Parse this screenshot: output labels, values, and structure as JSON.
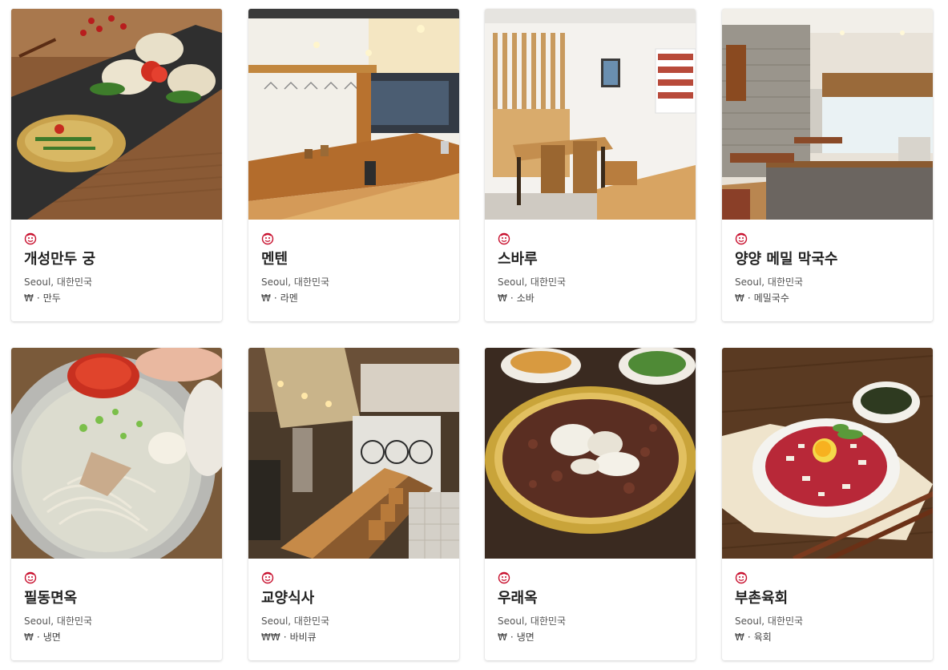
{
  "restaurants": [
    {
      "name": "개성만두 궁",
      "location": "Seoul, 대한민국",
      "price": "₩",
      "separator": "·",
      "category": "만두",
      "badge_icon": "michelin-bib-gourmand-icon",
      "photo": "dumplings-and-pancake-plate"
    },
    {
      "name": "멘텐",
      "location": "Seoul, 대한민국",
      "price": "₩",
      "separator": "·",
      "category": "라멘",
      "badge_icon": "michelin-bib-gourmand-icon",
      "photo": "wooden-counter-interior"
    },
    {
      "name": "스바루",
      "location": "Seoul, 대한민국",
      "price": "₩",
      "separator": "·",
      "category": "소바",
      "badge_icon": "michelin-bib-gourmand-icon",
      "photo": "wooden-tables-dining-room"
    },
    {
      "name": "양양 메밀 막국수",
      "location": "Seoul, 대한민국",
      "price": "₩",
      "separator": "·",
      "category": "메밀국수",
      "badge_icon": "michelin-bib-gourmand-icon",
      "photo": "brick-wall-dining-room"
    },
    {
      "name": "필동면옥",
      "location": "Seoul, 대한민국",
      "price": "₩",
      "separator": "·",
      "category": "냉면",
      "badge_icon": "michelin-bib-gourmand-icon",
      "photo": "cold-noodle-bowl"
    },
    {
      "name": "교양식사",
      "location": "Seoul, 대한민국",
      "price": "₩₩",
      "separator": "·",
      "category": "바비큐",
      "badge_icon": "michelin-bib-gourmand-icon",
      "photo": "bar-counter-interior"
    },
    {
      "name": "우래옥",
      "location": "Seoul, 대한민국",
      "price": "₩",
      "separator": "·",
      "category": "냉면",
      "badge_icon": "michelin-bib-gourmand-icon",
      "photo": "bulgogi-brass-pan"
    },
    {
      "name": "부촌육회",
      "location": "Seoul, 대한민국",
      "price": "₩",
      "separator": "·",
      "category": "육회",
      "badge_icon": "michelin-bib-gourmand-icon",
      "photo": "beef-tartare-plate"
    }
  ],
  "colors": {
    "badge": "#c8102e",
    "title": "#222222",
    "subtext": "#555555"
  }
}
